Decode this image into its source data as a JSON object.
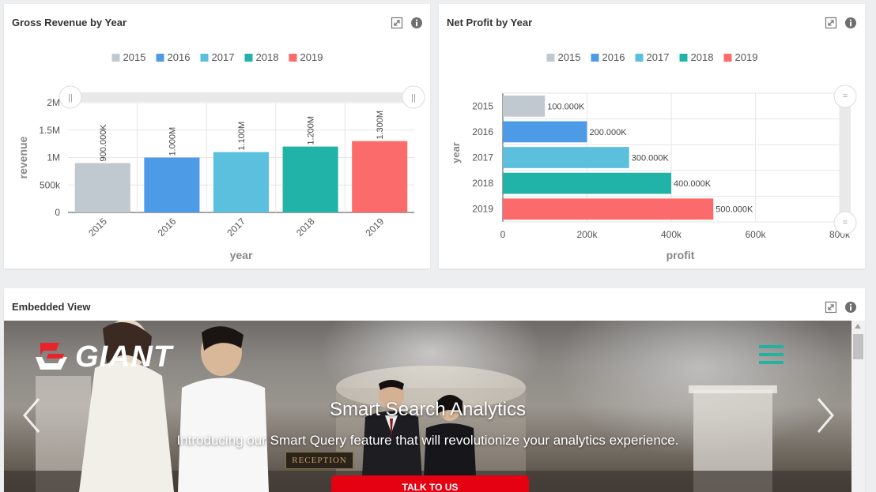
{
  "panels": {
    "revenue": {
      "title": "Gross Revenue by Year",
      "icons": [
        "expand-icon",
        "info-icon"
      ]
    },
    "profit": {
      "title": "Net Profit by Year",
      "icons": [
        "expand-icon",
        "info-icon"
      ]
    },
    "embed": {
      "title": "Embedded View",
      "icons": [
        "expand-icon",
        "info-icon"
      ]
    }
  },
  "chart_data": [
    {
      "type": "bar",
      "orientation": "vertical",
      "title": "Gross Revenue by Year",
      "xlabel": "year",
      "ylabel": "revenue",
      "categories": [
        "2015",
        "2016",
        "2017",
        "2018",
        "2019"
      ],
      "values": [
        900000,
        1000000,
        1100000,
        1200000,
        1300000
      ],
      "value_labels": [
        "900.000K",
        "1.000M",
        "1.100M",
        "1.200M",
        "1.300M"
      ],
      "yticks": [
        "0",
        "500k",
        "1M",
        "1.5M",
        "2M"
      ],
      "ylim": [
        0,
        2000000
      ],
      "legend": [
        "2015",
        "2016",
        "2017",
        "2018",
        "2019"
      ],
      "legend_position": "top",
      "colors": [
        "#c0c8d0",
        "#4d9be6",
        "#5bbfde",
        "#21b3a8",
        "#fb6b6b"
      ],
      "grid": true
    },
    {
      "type": "bar",
      "orientation": "horizontal",
      "title": "Net Profit by Year",
      "xlabel": "profit",
      "ylabel": "year",
      "categories": [
        "2015",
        "2016",
        "2017",
        "2018",
        "2019"
      ],
      "values": [
        100000,
        200000,
        300000,
        400000,
        500000
      ],
      "value_labels": [
        "100.000K",
        "200.000K",
        "300.000K",
        "400.000K",
        "500.000K"
      ],
      "xticks": [
        "0",
        "200k",
        "400k",
        "600k",
        "800k"
      ],
      "xlim": [
        0,
        800000
      ],
      "legend": [
        "2015",
        "2016",
        "2017",
        "2018",
        "2019"
      ],
      "legend_position": "top",
      "colors": [
        "#c0c8d0",
        "#4d9be6",
        "#5bbfde",
        "#21b3a8",
        "#fb6b6b"
      ],
      "grid": true
    }
  ],
  "embed": {
    "logo_text": "GIANT",
    "hero_title": "Smart Search Analytics",
    "hero_subtitle": "Introducing our Smart Query feature that will revolutionize your analytics experience.",
    "cta_label": "TALK TO US",
    "sign_text": "RECEPTION",
    "accent_color": "#21b3a0",
    "cta_color": "#e50012"
  }
}
